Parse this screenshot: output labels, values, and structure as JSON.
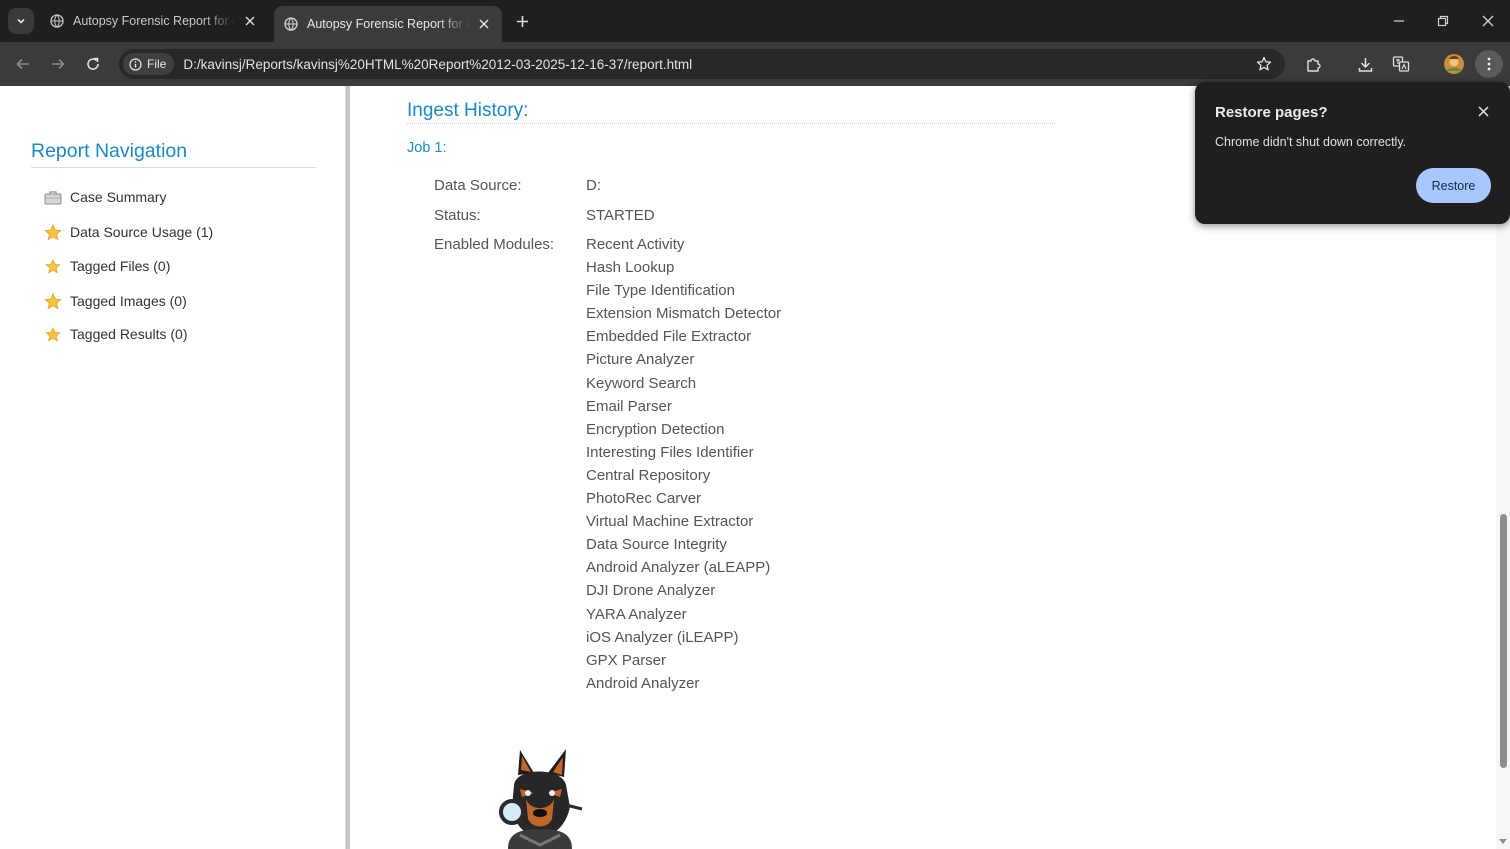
{
  "browser": {
    "tabs": [
      {
        "title": "Autopsy Forensic Report for case",
        "active": false
      },
      {
        "title": "Autopsy Forensic Report for case",
        "active": true
      }
    ],
    "url_chip": "File",
    "url": "D:/kavinsj/Reports/kavinsj%20HTML%20Report%2012-03-2025-12-16-37/report.html",
    "icons": [
      "tab-search-icon",
      "globe-icon",
      "close-icon",
      "plus-icon",
      "minimize-icon",
      "restore-window-icon",
      "back-arrow-icon",
      "forward-arrow-icon",
      "reload-icon",
      "info-icon",
      "star-icon",
      "extensions-icon",
      "download-icon",
      "translate-icon",
      "avatar",
      "kebab-menu-icon"
    ]
  },
  "popup": {
    "title": "Restore pages?",
    "message": "Chrome didn't shut down correctly.",
    "button": "Restore",
    "accent": "#a8c7fa"
  },
  "nav": {
    "title": "Report Navigation",
    "items": [
      {
        "label": "Case Summary",
        "icon": "briefcase-icon"
      },
      {
        "label": "Data Source Usage (1)",
        "icon": "star-icon"
      },
      {
        "label": "Tagged Files (0)",
        "icon": "star-icon"
      },
      {
        "label": "Tagged Images (0)",
        "icon": "star-icon"
      },
      {
        "label": "Tagged Results (0)",
        "icon": "star-icon"
      }
    ]
  },
  "ingest": {
    "heading": "Ingest History:",
    "job": "Job 1:",
    "data_source_label": "Data Source:",
    "data_source_value": "D:",
    "status_label": "Status:",
    "status_value": "STARTED",
    "modules_label": "Enabled Modules:",
    "modules": [
      "Recent Activity",
      "Hash Lookup",
      "File Type Identification",
      "Extension Mismatch Detector",
      "Embedded File Extractor",
      "Picture Analyzer",
      "Keyword Search",
      "Email Parser",
      "Encryption Detection",
      "Interesting Files Identifier",
      "Central Repository",
      "PhotoRec Carver",
      "Virtual Machine Extractor",
      "Data Source Integrity",
      "Android Analyzer (aLEAPP)",
      "DJI Drone Analyzer",
      "YARA Analyzer",
      "iOS Analyzer (iLEAPP)",
      "GPX Parser",
      "Android Analyzer"
    ]
  },
  "colors": {
    "heading_blue": "#1b8ac0",
    "chrome_dark": "#1f1f1f",
    "toolbar": "#3b3b3b"
  }
}
